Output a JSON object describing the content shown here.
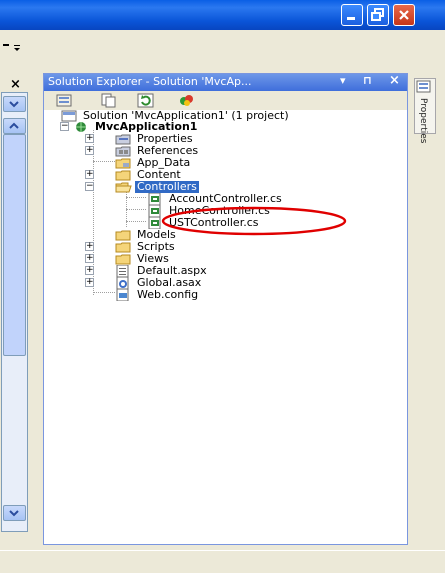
{
  "colors": {
    "titlebar": "#0A55D8",
    "selection": "#316AC5",
    "annotation": "#E00000"
  },
  "left_panel": {
    "close_glyph": "×"
  },
  "solution_explorer": {
    "title": "Solution Explorer - Solution 'MvcAp...",
    "title_dropdown_glyph": "▾",
    "pin_glyph": "⊓",
    "close_glyph": "×",
    "toolbar_icons": [
      "properties-icon",
      "show-all-files-icon",
      "refresh-icon",
      "class-diagram-icon"
    ]
  },
  "tree": {
    "solution": "Solution 'MvcApplication1' (1 project)",
    "project": "MvcApplication1",
    "items": [
      {
        "label": "Properties",
        "icon": "properties-folder-icon"
      },
      {
        "label": "References",
        "icon": "references-icon"
      },
      {
        "label": "App_Data",
        "icon": "folder-icon"
      },
      {
        "label": "Content",
        "icon": "folder-icon"
      },
      {
        "label": "Controllers",
        "icon": "open-folder-icon"
      },
      {
        "label": "AccountController.cs",
        "icon": "cs-file-icon"
      },
      {
        "label": "HomeController.cs",
        "icon": "cs-file-icon"
      },
      {
        "label": "USTController.cs",
        "icon": "cs-file-icon"
      },
      {
        "label": "Models",
        "icon": "folder-icon"
      },
      {
        "label": "Scripts",
        "icon": "folder-icon"
      },
      {
        "label": "Views",
        "icon": "folder-icon"
      },
      {
        "label": "Default.aspx",
        "icon": "aspx-file-icon"
      },
      {
        "label": "Global.asax",
        "icon": "asax-file-icon"
      },
      {
        "label": "Web.config",
        "icon": "config-file-icon"
      }
    ]
  },
  "side_tabs": {
    "properties": "Properties"
  }
}
